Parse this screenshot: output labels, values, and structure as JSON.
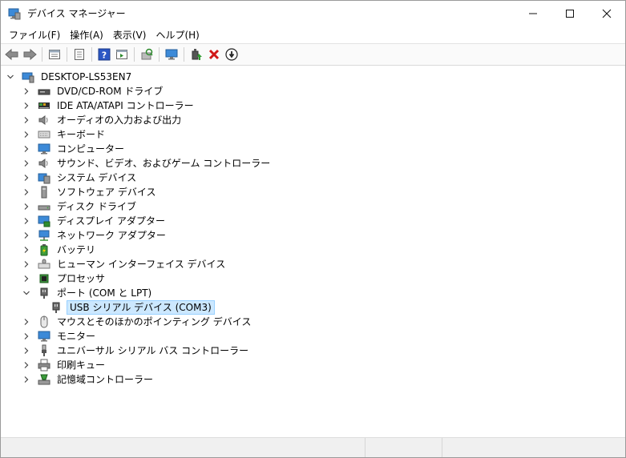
{
  "window": {
    "title": "デバイス マネージャー",
    "controls": [
      "minimize-icon",
      "maximize-icon",
      "close-icon"
    ]
  },
  "menu": {
    "items": [
      "ファイル(F)",
      "操作(A)",
      "表示(V)",
      "ヘルプ(H)"
    ]
  },
  "toolbar": {
    "icons": [
      "back-arrow-icon",
      "forward-arrow-icon",
      "properties-view-icon",
      "details-icon",
      "help-icon",
      "console-tree-icon",
      "scan-hardware-icon",
      "monitor-icon",
      "update-driver-icon",
      "uninstall-icon",
      "disable-device-icon"
    ]
  },
  "tree": {
    "root": "DESKTOP-LS53EN7",
    "categories": [
      {
        "label": "DVD/CD-ROM ドライブ",
        "icon": "dvd-drive-icon"
      },
      {
        "label": "IDE ATA/ATAPI コントローラー",
        "icon": "ide-controller-icon"
      },
      {
        "label": "オーディオの入力および出力",
        "icon": "speaker-icon"
      },
      {
        "label": "キーボード",
        "icon": "keyboard-icon"
      },
      {
        "label": "コンピューター",
        "icon": "computer-icon"
      },
      {
        "label": "サウンド、ビデオ、およびゲーム コントローラー",
        "icon": "speaker-icon"
      },
      {
        "label": "システム デバイス",
        "icon": "system-device-icon"
      },
      {
        "label": "ソフトウェア デバイス",
        "icon": "software-device-icon"
      },
      {
        "label": "ディスク ドライブ",
        "icon": "disk-drive-icon"
      },
      {
        "label": "ディスプレイ アダプター",
        "icon": "display-adapter-icon"
      },
      {
        "label": "ネットワーク アダプター",
        "icon": "network-adapter-icon"
      },
      {
        "label": "バッテリ",
        "icon": "battery-icon"
      },
      {
        "label": "ヒューマン インターフェイス デバイス",
        "icon": "hid-icon"
      },
      {
        "label": "プロセッサ",
        "icon": "processor-icon"
      },
      {
        "label": "ポート (COM と LPT)",
        "icon": "port-icon",
        "expanded": true
      },
      {
        "label": "USB シリアル デバイス (COM3)",
        "icon": "port-icon",
        "child": true,
        "selected": true
      },
      {
        "label": "マウスとそのほかのポインティング デバイス",
        "icon": "mouse-icon"
      },
      {
        "label": "モニター",
        "icon": "monitor-icon"
      },
      {
        "label": "ユニバーサル シリアル バス コントローラー",
        "icon": "usb-icon"
      },
      {
        "label": "印刷キュー",
        "icon": "printer-icon"
      },
      {
        "label": "記憶域コントローラー",
        "icon": "storage-controller-icon"
      }
    ]
  }
}
